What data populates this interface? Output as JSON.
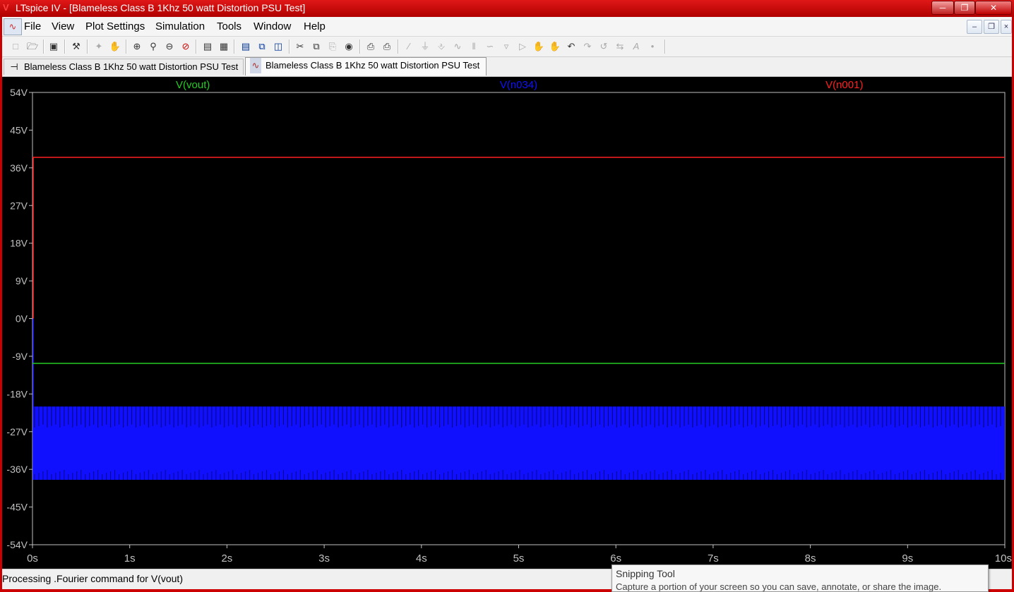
{
  "window": {
    "title": "LTspice IV - [Blameless Class B 1Khz 50 watt Distortion PSU Test]",
    "app_icon": "ltspice-icon",
    "controls": [
      "minimize",
      "restore",
      "close"
    ],
    "frame_color": "#cc0000"
  },
  "menubar": {
    "items": [
      {
        "label": "File",
        "hotkey": "F"
      },
      {
        "label": "View",
        "hotkey": "V"
      },
      {
        "label": "Plot Settings",
        "hotkey": "P"
      },
      {
        "label": "Simulation",
        "hotkey": "S"
      },
      {
        "label": "Tools",
        "hotkey": "T"
      },
      {
        "label": "Window",
        "hotkey": "W"
      },
      {
        "label": "Help",
        "hotkey": "H"
      }
    ]
  },
  "toolbar": {
    "icons": [
      "new-schematic-icon",
      "open-icon",
      "save-icon",
      "control-panel-icon",
      "run-icon",
      "halt-icon",
      "pan-icon",
      "zoom-in-icon",
      "zoom-in-area-icon",
      "zoom-out-icon",
      "zoom-cancel-icon",
      "autorange-icon",
      "plot-settings-icon",
      "tile-horizontal-icon",
      "cascade-icon",
      "tile-vertical-icon",
      "cut-icon",
      "copy-icon",
      "paste-icon",
      "find-icon",
      "print-setup-icon",
      "print-icon",
      "wire-icon",
      "ground-icon",
      "label-net-icon",
      "resistor-icon",
      "capacitor-icon",
      "inductor-icon",
      "diode-icon",
      "component-icon",
      "move-icon",
      "drag-icon",
      "undo-icon",
      "redo-icon",
      "rotate-icon",
      "mirror-icon",
      "text-icon",
      "spice-directive-icon"
    ]
  },
  "tabs": [
    {
      "label": "Blameless Class B 1Khz 50 watt Distortion PSU Test",
      "icon": "schematic-icon",
      "active": false
    },
    {
      "label": "Blameless Class B 1Khz 50 watt Distortion PSU Test",
      "icon": "waveform-icon",
      "active": true
    }
  ],
  "status": {
    "text": "Processing .Fourier command for V(vout)"
  },
  "snipping_tool": {
    "title": "Snipping Tool",
    "description": "Capture a portion of your screen so you can save, annotate, or share the image."
  },
  "chart_data": {
    "type": "line",
    "xlabel": "",
    "ylabel": "",
    "x_ticks": [
      "0s",
      "1s",
      "2s",
      "3s",
      "4s",
      "5s",
      "6s",
      "7s",
      "8s",
      "9s",
      "10s"
    ],
    "y_ticks": [
      "54V",
      "45V",
      "36V",
      "27V",
      "18V",
      "9V",
      "0V",
      "-9V",
      "-18V",
      "-27V",
      "-36V",
      "-45V",
      "-54V"
    ],
    "xlim": [
      0,
      10
    ],
    "ylim": [
      -54,
      54
    ],
    "grid": false,
    "series": [
      {
        "name": "V(vout)",
        "color": "#22cc22",
        "kind": "constant",
        "values": [
          -10.7,
          -10.7
        ]
      },
      {
        "name": "V(n034)",
        "color": "#1010ff",
        "kind": "band",
        "band_min": -38.5,
        "band_max": -21,
        "ripple_to": -26
      },
      {
        "name": "V(n001)",
        "color": "#ff2020",
        "kind": "constant",
        "values": [
          38.5,
          38.5
        ]
      }
    ],
    "x": [
      0,
      10
    ]
  }
}
